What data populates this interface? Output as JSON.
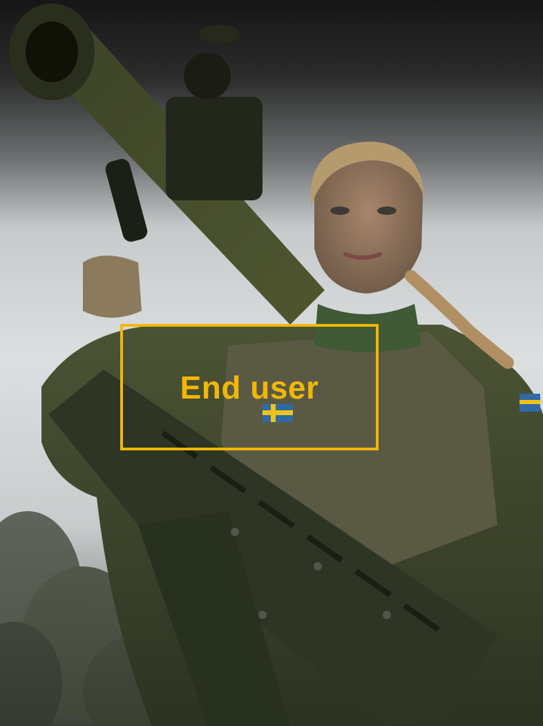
{
  "overlay": {
    "label": "End user",
    "accent_color": "#F2B705"
  },
  "photo": {
    "subject_icon": "soldier-with-shoulder-launcher-photo"
  }
}
